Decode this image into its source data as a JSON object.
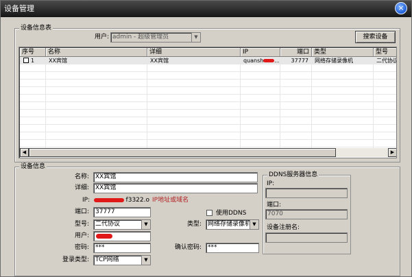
{
  "window": {
    "title": "设备管理",
    "close_glyph": "×"
  },
  "device_list": {
    "group_title": "设备信息表",
    "user_label": "用户:",
    "user_value": "admin - 超级管理员",
    "search_button": "搜索设备",
    "columns": [
      "序号",
      "名称",
      "详细",
      "IP",
      "端口",
      "类型",
      "型号"
    ],
    "rows": [
      {
        "index": "1",
        "name": "XX宾馆",
        "detail": "XX宾馆",
        "ip": "quansh",
        "ip_suffix": "...",
        "port": "37777",
        "type": "网络存储录像机",
        "model": "二代协议"
      }
    ]
  },
  "device_info": {
    "group_title": "设备信息",
    "name_label": "名称:",
    "name_value": "XX宾馆",
    "detail_label": "详细:",
    "detail_value": "XX宾馆",
    "ip_label": "IP:",
    "ip_value": "f3322.o",
    "ip_hint": "IP地址或域名",
    "port_label": "端口:",
    "port_value": "37777",
    "use_ddns_label": "使用DDNS",
    "model_label": "型号:",
    "model_value": "二代协议",
    "type_label": "类型:",
    "type_value": "网络存储录像机",
    "user_label": "用户:",
    "user_value": "",
    "password_label": "密码:",
    "password_value": "***",
    "confirm_password_label": "确认密码:",
    "confirm_password_value": "***",
    "login_type_label": "登录类型:",
    "login_type_value": "TCP网络"
  },
  "ddns": {
    "group_title": "DDNS服务器信息",
    "ip_label": "IP:",
    "ip_value": "",
    "port_label": "端口:",
    "port_value": "7070",
    "register_name_label": "设备注册名:",
    "register_name_value": ""
  },
  "colors": {
    "redaction": "#e01818",
    "hint_text": "#b22222",
    "window_bg": "#d4d0c8"
  }
}
